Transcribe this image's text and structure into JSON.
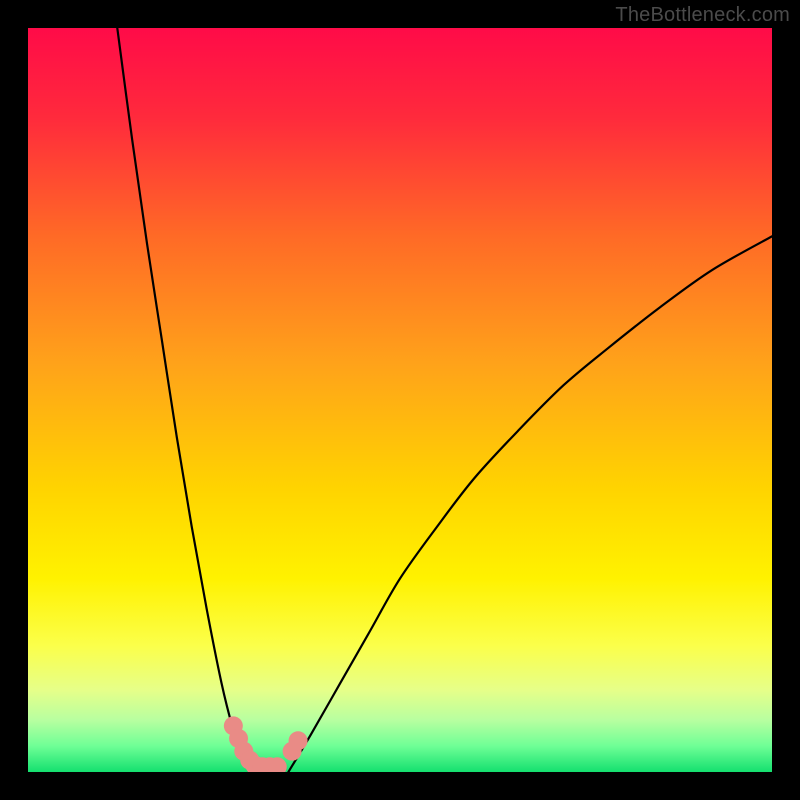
{
  "watermark": "TheBottleneck.com",
  "chart_data": {
    "type": "line",
    "title": "",
    "xlabel": "",
    "ylabel": "",
    "xlim": [
      0,
      100
    ],
    "ylim": [
      0,
      100
    ],
    "grid": false,
    "series": [
      {
        "name": "curve-left",
        "x": [
          12,
          14,
          16,
          18,
          20,
          22,
          24,
          26,
          27.5,
          29,
          30
        ],
        "y": [
          100,
          85,
          71,
          58,
          45,
          33,
          22,
          12,
          6,
          1.5,
          0
        ]
      },
      {
        "name": "curve-right",
        "x": [
          35,
          38,
          42,
          46,
          50,
          55,
          60,
          66,
          72,
          78,
          85,
          92,
          100
        ],
        "y": [
          0,
          5,
          12,
          19,
          26,
          33,
          39.5,
          46,
          52,
          57,
          62.5,
          67.5,
          72
        ]
      }
    ],
    "annotations": {
      "green_band_y": [
        0,
        3
      ],
      "pink_markers": [
        {
          "x": 27.6,
          "y": 6.2
        },
        {
          "x": 28.3,
          "y": 4.5
        },
        {
          "x": 29.0,
          "y": 2.8
        },
        {
          "x": 29.8,
          "y": 1.6
        },
        {
          "x": 30.5,
          "y": 0.9
        },
        {
          "x": 31.5,
          "y": 0.7
        },
        {
          "x": 32.5,
          "y": 0.7
        },
        {
          "x": 33.5,
          "y": 0.7
        },
        {
          "x": 35.5,
          "y": 2.8
        },
        {
          "x": 36.3,
          "y": 4.2
        }
      ]
    },
    "background": {
      "type": "vertical-gradient",
      "stops": [
        {
          "pos": 0.0,
          "color": "#ff0b48"
        },
        {
          "pos": 0.12,
          "color": "#ff2a3c"
        },
        {
          "pos": 0.28,
          "color": "#ff6a26"
        },
        {
          "pos": 0.45,
          "color": "#ffa21a"
        },
        {
          "pos": 0.62,
          "color": "#ffd400"
        },
        {
          "pos": 0.74,
          "color": "#fff200"
        },
        {
          "pos": 0.83,
          "color": "#fbff4a"
        },
        {
          "pos": 0.89,
          "color": "#e6ff89"
        },
        {
          "pos": 0.93,
          "color": "#b8ffa0"
        },
        {
          "pos": 0.965,
          "color": "#6fff96"
        },
        {
          "pos": 1.0,
          "color": "#14e06f"
        }
      ]
    }
  }
}
